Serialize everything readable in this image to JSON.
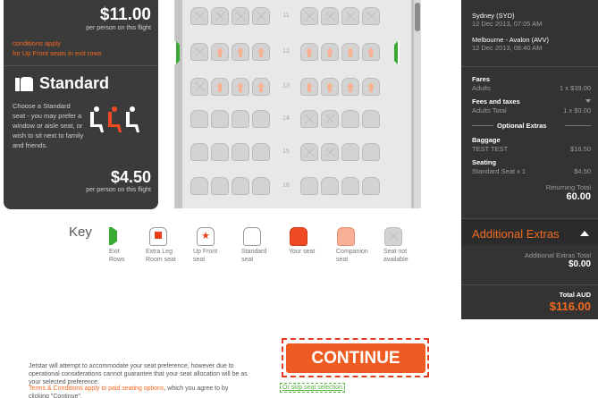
{
  "left_panel": {
    "faded_top": "",
    "upfront_price": "$11.00",
    "upfront_per": "per person on this flight",
    "conditions_line1": "conditions apply",
    "conditions_line2": "for Up Front seats in exit rows",
    "standard_title": "Standard",
    "standard_desc": "Choose a Standard seat - you may prefer a window or aisle seat, or wish to sit next to family and friends.",
    "standard_price": "$4.50",
    "standard_per": "per person on this flight"
  },
  "seatmap": {
    "rows": [
      "11",
      "12",
      "13",
      "14",
      "15",
      "16"
    ]
  },
  "key": {
    "title": "Key",
    "items": [
      {
        "label": "Exit Rows"
      },
      {
        "label": "Extra Leg Room seat"
      },
      {
        "label": "Up Front seat"
      },
      {
        "label": "Standard seat"
      },
      {
        "label": "Your seat"
      },
      {
        "label": "Companion seat"
      },
      {
        "label": "Seat not available"
      }
    ]
  },
  "summary": {
    "depart": "Sydney (SYD)",
    "depart_time": "12 Dec 2013, 07:05 AM",
    "arrive": "Melbourne - Avalon (AVV)",
    "arrive_time": "12 Dec 2013, 08:40 AM",
    "fares_label": "Fares",
    "adults_label": "Adults",
    "adults_value": "1 x $39.00",
    "fees_label": "Fees and taxes",
    "adults_total_label": "Adults Total",
    "adults_total_value": "1 x $0.00",
    "optional_extras": "Optional Extras",
    "baggage_label": "Baggage",
    "baggage_name": "TEST TEST",
    "baggage_value": "$16.50",
    "seating_label": "Seating",
    "seating_name": "Standard Seat x 1",
    "seating_value": "$4.50",
    "returning_total_label": "Returning Total",
    "returning_total_value": "60.00",
    "additional_extras_title": "Additional Extras",
    "additional_extras_total_label": "Additional Extras Total",
    "additional_extras_total_value": "$0.00",
    "total_label": "Total AUD",
    "total_value": "$116.00"
  },
  "footer": {
    "note": "Jetstar will attempt to accommodate your seat preference, however due to operational considerations cannot guarantee that your seat allocation will be as your selected preference.",
    "terms_link": "Terms & Conditions apply to paid seating options",
    "terms_rest": ", which you agree to by clicking \"Continue\".",
    "continue_label": "CONTINUE",
    "skip_label": "Or skip seat selection"
  }
}
